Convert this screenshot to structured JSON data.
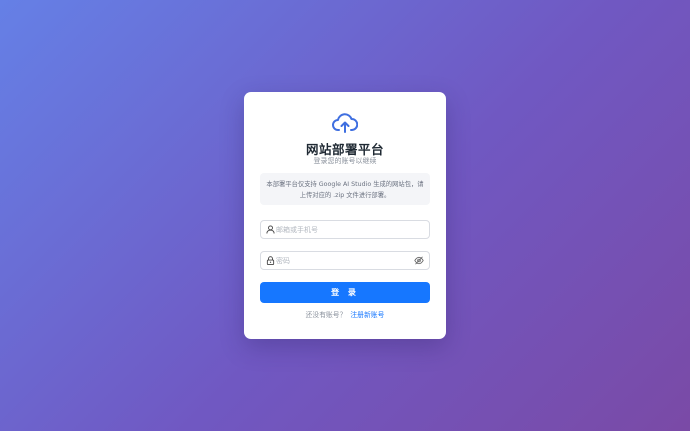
{
  "brand": {
    "icon": "cloud-upload-icon",
    "accent_color": "#1677ff",
    "logo_color": "#3f6fe0"
  },
  "login": {
    "title": "网站部署平台",
    "subtitle": "登录您的账号以继续",
    "notice": "本部署平台仅支持 Google AI Studio 生成的网站包，请上传对应的 .zip 文件进行部署。",
    "username_placeholder": "邮箱或手机号",
    "password_placeholder": "密码",
    "submit_label": "登 录",
    "no_account_text": "还没有账号？",
    "register_link": "注册新账号"
  }
}
